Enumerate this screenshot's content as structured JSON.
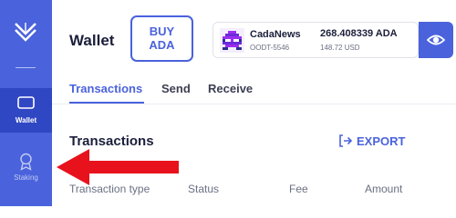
{
  "sidebar": {
    "logo_icon": "app-logo-icon",
    "items": [
      {
        "label": "Wallet",
        "icon": "wallet-icon",
        "active": true
      },
      {
        "label": "Staking",
        "icon": "staking-icon",
        "active": false
      }
    ]
  },
  "header": {
    "title": "Wallet",
    "buy_button": {
      "line1": "BUY",
      "line2": "ADA"
    },
    "wallet": {
      "name": "CadaNews",
      "id": "OODT-5546",
      "balance": "268.408339 ADA",
      "usd": "148.72 USD"
    },
    "eye_icon": "eye-icon"
  },
  "tabs": [
    {
      "label": "Transactions",
      "active": true
    },
    {
      "label": "Send",
      "active": false
    },
    {
      "label": "Receive",
      "active": false
    }
  ],
  "transactions": {
    "title": "Transactions",
    "export_label": "EXPORT",
    "columns": [
      "Transaction type",
      "Status",
      "Fee",
      "Amount"
    ]
  },
  "annotation": {
    "arrow_icon": "red-arrow-icon",
    "color": "#e8121c"
  },
  "colors": {
    "accent": "#4a62dc",
    "sidebar_active": "#3047c4"
  }
}
